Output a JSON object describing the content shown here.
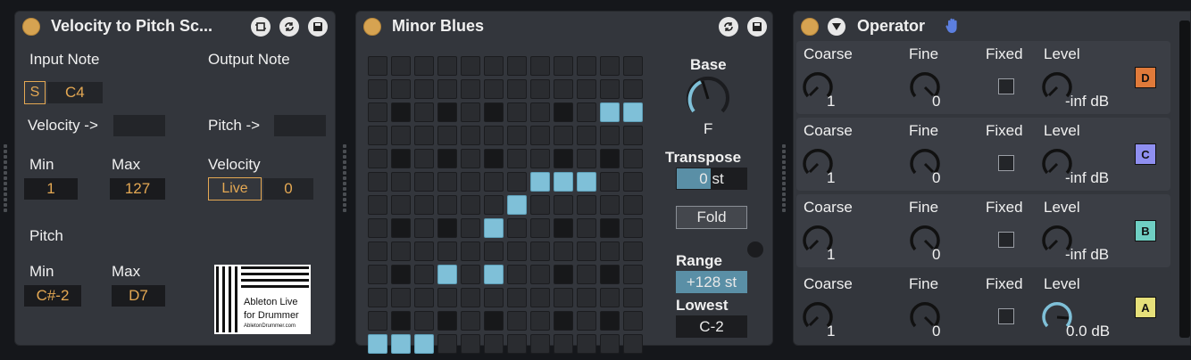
{
  "device1": {
    "title": "Velocity to Pitch Sc...",
    "input_note_label": "Input Note",
    "output_note_label": "Output Note",
    "s_toggle": "S",
    "input_note_value": "C4",
    "velocity_arrow_label": "Velocity ->",
    "pitch_arrow_label": "Pitch ->",
    "vel_min_label": "Min",
    "vel_max_label": "Max",
    "vel_min_value": "1",
    "vel_max_value": "127",
    "velocity_label": "Velocity",
    "live_button": "Live",
    "velocity_value": "0",
    "pitch_label": "Pitch",
    "pitch_min_label": "Min",
    "pitch_max_label": "Max",
    "pitch_min_value": "C#-2",
    "pitch_max_value": "D7",
    "logo_line1": "Ableton Live",
    "logo_line2": "for Drummer",
    "logo_line3": "AbletonDrummer.com"
  },
  "device2": {
    "title": "Minor Blues",
    "base_label": "Base",
    "base_value": "F",
    "transpose_label": "Transpose",
    "transpose_value": "0 st",
    "fold_button": "Fold",
    "range_label": "Range",
    "range_value": "+128 st",
    "lowest_label": "Lowest",
    "lowest_value": "C-2",
    "grid": {
      "rows": 13,
      "cols": 12,
      "active": [
        [
          2,
          10
        ],
        [
          2,
          11
        ],
        [
          5,
          7
        ],
        [
          5,
          8
        ],
        [
          5,
          9
        ],
        [
          6,
          6
        ],
        [
          7,
          5
        ],
        [
          9,
          3
        ],
        [
          9,
          5
        ],
        [
          12,
          0
        ],
        [
          12,
          1
        ],
        [
          12,
          2
        ]
      ],
      "dark_rows": [
        2,
        4,
        7,
        9,
        11
      ],
      "dark_cols": [
        1,
        3,
        5,
        8,
        10
      ]
    }
  },
  "device3": {
    "title": "Operator",
    "oscillators": [
      {
        "coarse_label": "Coarse",
        "fine_label": "Fine",
        "fixed_label": "Fixed",
        "level_label": "Level",
        "coarse": "1",
        "fine": "0",
        "level": "-inf dB",
        "letter": "D",
        "color": "#e07a3a"
      },
      {
        "coarse_label": "Coarse",
        "fine_label": "Fine",
        "fixed_label": "Fixed",
        "level_label": "Level",
        "coarse": "1",
        "fine": "0",
        "level": "-inf dB",
        "letter": "C",
        "color": "#8f8ff0"
      },
      {
        "coarse_label": "Coarse",
        "fine_label": "Fine",
        "fixed_label": "Fixed",
        "level_label": "Level",
        "coarse": "1",
        "fine": "0",
        "level": "-inf dB",
        "letter": "B",
        "color": "#6fcfc3"
      },
      {
        "coarse_label": "Coarse",
        "fine_label": "Fine",
        "fixed_label": "Fixed",
        "level_label": "Level",
        "coarse": "1",
        "fine": "0",
        "level": "0.0 dB",
        "letter": "A",
        "color": "#e6e07a"
      }
    ]
  },
  "colors": {
    "accent_orange": "#e4a853",
    "accent_blue": "#7fc0d8",
    "panel": "#33363c"
  }
}
